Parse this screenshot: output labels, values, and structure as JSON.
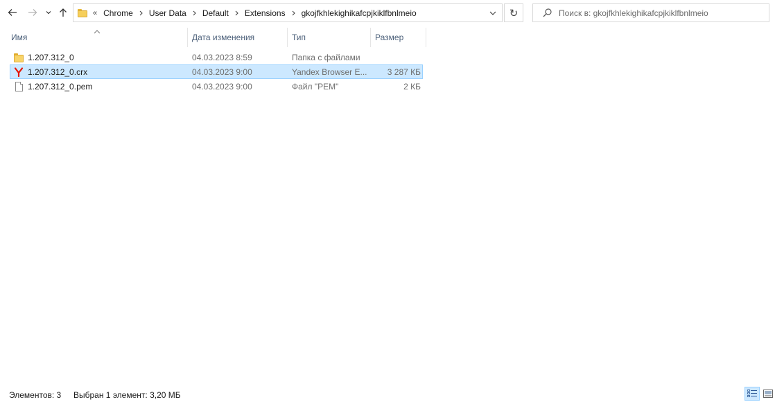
{
  "nav": {
    "back_icon": "arrow-left-icon",
    "forward_icon": "arrow-right-icon",
    "recent_icon": "chevron-down-icon",
    "up_icon": "arrow-up-icon"
  },
  "address": {
    "overflow": "«",
    "crumbs": [
      "Chrome",
      "User Data",
      "Default",
      "Extensions",
      "gkojfkhlekighikafcpjkiklfbnlmeio"
    ]
  },
  "refresh_glyph": "↻",
  "search": {
    "placeholder": "Поиск в: gkojfkhlekighikafcpjkiklfbnlmeio"
  },
  "columns": {
    "name": "Имя",
    "date": "Дата изменения",
    "type": "Тип",
    "size": "Размер"
  },
  "files": [
    {
      "icon": "folder-icon",
      "name": "1.207.312_0",
      "date": "04.03.2023 8:59",
      "type": "Папка с файлами",
      "size": "",
      "selected": false
    },
    {
      "icon": "yandex-browser-icon",
      "name": "1.207.312_0.crx",
      "date": "04.03.2023 9:00",
      "type": "Yandex Browser E...",
      "size": "3 287 КБ",
      "selected": true
    },
    {
      "icon": "file-icon",
      "name": "1.207.312_0.pem",
      "date": "04.03.2023 9:00",
      "type": "Файл \"PEM\"",
      "size": "2 КБ",
      "selected": false
    }
  ],
  "status": {
    "items_count": "Элементов: 3",
    "selected": "Выбран 1 элемент: 3,20 МБ"
  },
  "colors": {
    "selection_bg": "#cce8ff",
    "selection_border": "#99d1ff",
    "header_text": "#4c607a",
    "yandex_red": "#e61400"
  }
}
